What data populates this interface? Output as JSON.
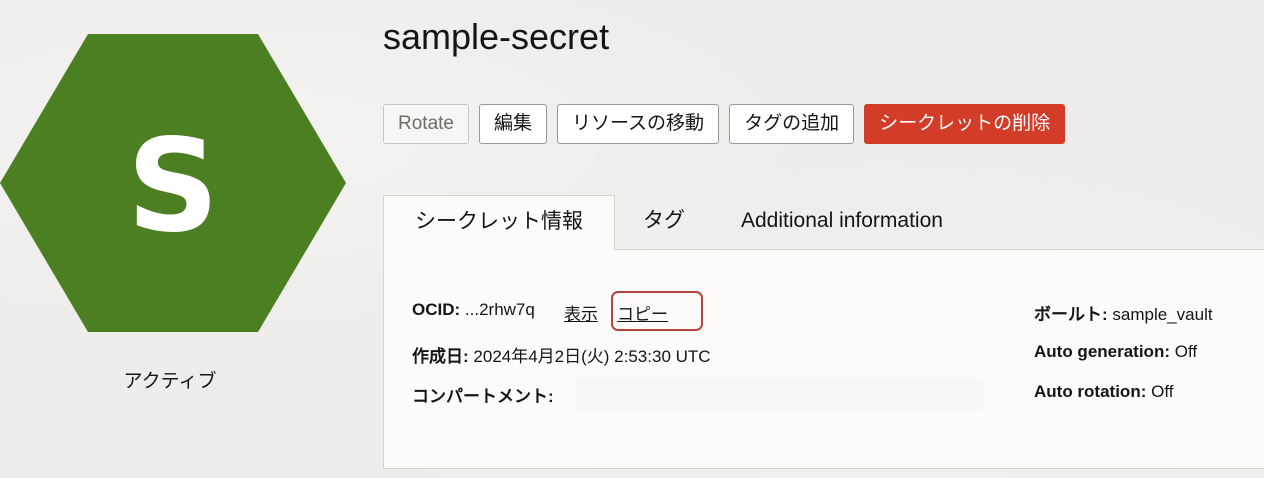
{
  "resource": {
    "icon_letter": "S",
    "icon_color": "#4b7f22",
    "status": "アクティブ",
    "name": "sample-secret"
  },
  "actions": {
    "rotate": "Rotate",
    "edit": "編集",
    "move": "リソースの移動",
    "add_tag": "タグの追加",
    "delete": "シークレットの削除"
  },
  "tabs": [
    "シークレット情報",
    "タグ",
    "Additional information"
  ],
  "details": {
    "ocid_label": "OCID:",
    "ocid_value": "...2rhw7q",
    "show_link": "表示",
    "copy_link": "コピー",
    "created_label": "作成日:",
    "created_value": "2024年4月2日(火) 2:53:30 UTC",
    "compartment_label": "コンパートメント:",
    "vault_label": "ボールト:",
    "vault_value": "sample_vault",
    "autogen_label": "Auto generation:",
    "autogen_value": "Off",
    "autorot_label": "Auto rotation:",
    "autorot_value": "Off"
  },
  "colors": {
    "danger": "#d23c28",
    "highlight": "#b5453b"
  }
}
